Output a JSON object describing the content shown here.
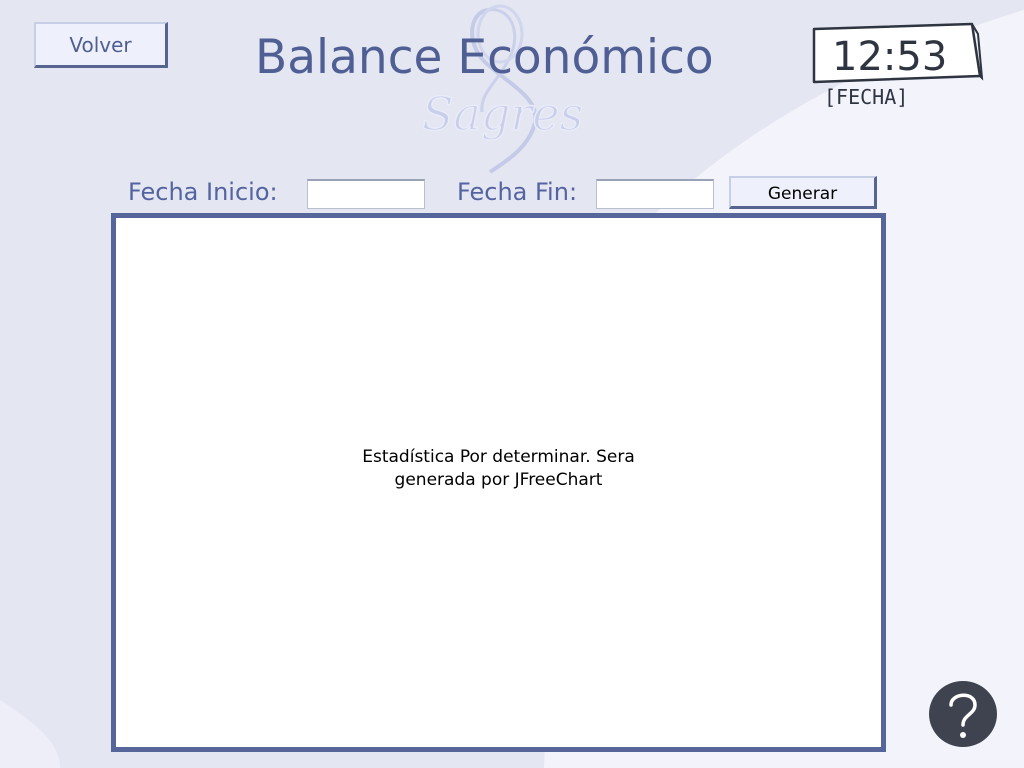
{
  "header": {
    "back_label": "Volver",
    "title": "Balance Económico",
    "logo_text": "Sagres"
  },
  "clock": {
    "time": "12:53",
    "date_placeholder": "[FECHA]"
  },
  "form": {
    "start_label": "Fecha Inicio:",
    "start_value": "",
    "end_label": "Fecha Fin:",
    "end_value": "",
    "generate_label": "Generar"
  },
  "chart_panel": {
    "placeholder_line1": "Estadística Por determinar. Sera",
    "placeholder_line2": "generada por JFreeChart"
  },
  "help": {
    "icon": "question-mark-icon"
  },
  "colors": {
    "accent": "#56659a",
    "title": "#4f5f94",
    "background": "#e4e6f2",
    "help_bg": "#3f4350"
  }
}
